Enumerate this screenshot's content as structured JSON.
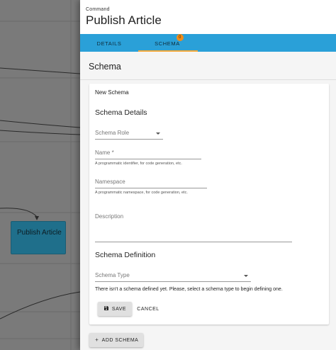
{
  "canvas": {
    "node_label": "Publish Article"
  },
  "header": {
    "eyebrow": "Command",
    "title": "Publish Article"
  },
  "tabs": [
    {
      "label": "DETAILS",
      "active": false
    },
    {
      "label": "SCHEMA",
      "active": true,
      "badge": "0"
    }
  ],
  "section_title": "Schema",
  "card": {
    "new_schema": "New Schema",
    "details_heading": "Schema Details",
    "role_label": "Schema Role",
    "name_label": "Name *",
    "name_helper": "A programmatic identifier, for code generation, etc.",
    "namespace_label": "Namespace",
    "namespace_helper": "A programmatic namespace, for code generation, etc.",
    "description_label": "Description",
    "definition_heading": "Schema Definition",
    "type_label": "Schema Type",
    "info_text": "There isn't a schema defined yet. Please, select a schema type to begin defining one.",
    "save_label": "SAVE",
    "cancel_label": "CANCEL"
  },
  "add_schema_label": "ADD SCHEMA",
  "colors": {
    "tab_bar": "#2aa0d8",
    "tab_indicator": "#f4a93a",
    "badge": "#f08c1a",
    "node": "#1f6f8b"
  },
  "icons": {
    "save": "floppy-disk-icon",
    "add": "plus-icon"
  }
}
